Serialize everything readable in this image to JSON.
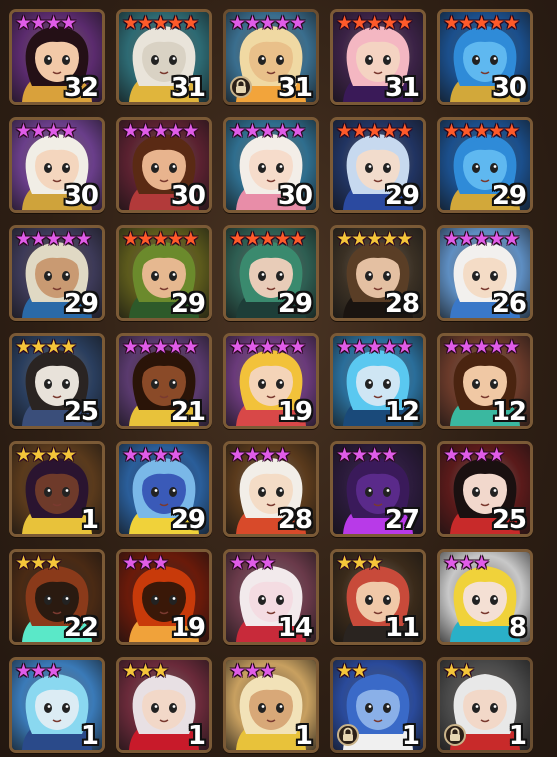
{
  "colors": {
    "star_purple": "#e05ce8",
    "star_red": "#ff5a2a",
    "star_gold": "#f5c53a"
  },
  "monsters": [
    {
      "level": "32",
      "stars": 4,
      "star_color": "#e05ce8",
      "bg": "#5b2b6e",
      "hair": "#241016",
      "skin": "#f2c9a8",
      "accent": "#d9a13b",
      "locked": false
    },
    {
      "level": "31",
      "stars": 5,
      "star_color": "#ff5a2a",
      "bg": "#2d6a73",
      "hair": "#e9e4da",
      "skin": "#d9d2c4",
      "accent": "#e0b53c",
      "locked": false
    },
    {
      "level": "31",
      "stars": 5,
      "star_color": "#e05ce8",
      "bg": "#3a6e8e",
      "hair": "#f0d9a3",
      "skin": "#e9c08a",
      "accent": "#f2a43b",
      "locked": true
    },
    {
      "level": "31",
      "stars": 5,
      "star_color": "#ff5a2a",
      "bg": "#3b2246",
      "hair": "#f4b7c2",
      "skin": "#f4d3c2",
      "accent": "#3a1a58",
      "locked": false
    },
    {
      "level": "30",
      "stars": 5,
      "star_color": "#ff5a2a",
      "bg": "#1b4f8c",
      "hair": "#2f8bd8",
      "skin": "#5fb8f0",
      "accent": "#d2a83a",
      "locked": false
    },
    {
      "level": "30",
      "stars": 4,
      "star_color": "#e05ce8",
      "bg": "#6a3e8a",
      "hair": "#f1eee6",
      "skin": "#f4d6be",
      "accent": "#cfa33b",
      "locked": false
    },
    {
      "level": "30",
      "stars": 5,
      "star_color": "#e05ce8",
      "bg": "#5a2130",
      "hair": "#5a2a14",
      "skin": "#e8b48e",
      "accent": "#b23a3a",
      "locked": false
    },
    {
      "level": "30",
      "stars": 5,
      "star_color": "#e05ce8",
      "bg": "#2f6e8e",
      "hair": "#f3eee8",
      "skin": "#f6dccb",
      "accent": "#e88da8",
      "locked": false
    },
    {
      "level": "29",
      "stars": 5,
      "star_color": "#ff5a2a",
      "bg": "#213462",
      "hair": "#c7d9ef",
      "skin": "#f2dccc",
      "accent": "#2b4aa0",
      "locked": false
    },
    {
      "level": "29",
      "stars": 5,
      "star_color": "#ff5a2a",
      "bg": "#1b4f8c",
      "hair": "#2f8bd8",
      "skin": "#5fb8f0",
      "accent": "#d2a83a",
      "locked": false
    },
    {
      "level": "29",
      "stars": 5,
      "star_color": "#e05ce8",
      "bg": "#3d3a58",
      "hair": "#e0d9c4",
      "skin": "#c99a72",
      "accent": "#2b6aa8",
      "locked": false
    },
    {
      "level": "29",
      "stars": 5,
      "star_color": "#ff5a2a",
      "bg": "#5c5a1c",
      "hair": "#6b8a2c",
      "skin": "#e6b890",
      "accent": "#2e5a2a",
      "locked": false
    },
    {
      "level": "29",
      "stars": 5,
      "star_color": "#ff5a2a",
      "bg": "#2e5e52",
      "hair": "#3a8a6e",
      "skin": "#e8ccb8",
      "accent": "#1e3e38",
      "locked": false
    },
    {
      "level": "28",
      "stars": 5,
      "star_color": "#f5c53a",
      "bg": "#3a3024",
      "hair": "#5a3e26",
      "skin": "#e4c0a2",
      "accent": "#1a1410",
      "locked": false
    },
    {
      "level": "26",
      "stars": 5,
      "star_color": "#e05ce8",
      "bg": "#5e8ec2",
      "hair": "#f2f0ee",
      "skin": "#f4dcc6",
      "accent": "#3a78c8",
      "locked": false
    },
    {
      "level": "25",
      "stars": 4,
      "star_color": "#f5c53a",
      "bg": "#2a3e5e",
      "hair": "#2a2422",
      "skin": "#e8e2da",
      "accent": "#3a4e7a",
      "locked": false
    },
    {
      "level": "21",
      "stars": 5,
      "star_color": "#e05ce8",
      "bg": "#5a3a6e",
      "hair": "#2a1408",
      "skin": "#8a4a28",
      "accent": "#e8c23a",
      "locked": false
    },
    {
      "level": "19",
      "stars": 5,
      "star_color": "#e05ce8",
      "bg": "#6a3a7a",
      "hair": "#f2c23a",
      "skin": "#f4d4b8",
      "accent": "#d84848",
      "locked": false
    },
    {
      "level": "12",
      "stars": 5,
      "star_color": "#e05ce8",
      "bg": "#2a6e9a",
      "hair": "#5ac8f0",
      "skin": "#cfe6f4",
      "accent": "#1a4a7a",
      "locked": false
    },
    {
      "level": "12",
      "stars": 5,
      "star_color": "#e05ce8",
      "bg": "#6a3a2a",
      "hair": "#4a2410",
      "skin": "#f0c8a4",
      "accent": "#3ab8a0",
      "locked": false
    },
    {
      "level": "1",
      "stars": 4,
      "star_color": "#f5c53a",
      "bg": "#5a3a1c",
      "hair": "#2a1430",
      "skin": "#6e3a2a",
      "accent": "#e8c23a",
      "locked": false
    },
    {
      "level": "29",
      "stars": 4,
      "star_color": "#e05ce8",
      "bg": "#2a5e9a",
      "hair": "#7ab8e8",
      "skin": "#3a5ab8",
      "accent": "#f0d23a",
      "locked": false
    },
    {
      "level": "28",
      "stars": 4,
      "star_color": "#e05ce8",
      "bg": "#5a3a1c",
      "hair": "#f2eee8",
      "skin": "#f4dcc6",
      "accent": "#d84a2a",
      "locked": false
    },
    {
      "level": "27",
      "stars": 4,
      "star_color": "#e05ce8",
      "bg": "#2a1a3a",
      "hair": "#3a1a5a",
      "skin": "#5a2a8a",
      "accent": "#b83ae8",
      "locked": false
    },
    {
      "level": "25",
      "stars": 4,
      "star_color": "#e05ce8",
      "bg": "#5a1a1a",
      "hair": "#1a1010",
      "skin": "#f2d8cc",
      "accent": "#c82a2a",
      "locked": false
    },
    {
      "level": "22",
      "stars": 3,
      "star_color": "#f5c53a",
      "bg": "#4a2a14",
      "hair": "#8a3a1a",
      "skin": "#2a1a10",
      "accent": "#5ae8c8",
      "locked": false
    },
    {
      "level": "19",
      "stars": 3,
      "star_color": "#e05ce8",
      "bg": "#6a1a0a",
      "hair": "#c83a0a",
      "skin": "#3a1808",
      "accent": "#f0a23a",
      "locked": false
    },
    {
      "level": "14",
      "stars": 3,
      "star_color": "#e05ce8",
      "bg": "#6a3a4a",
      "hair": "#f2eaec",
      "skin": "#f4dce2",
      "accent": "#c82a3a",
      "locked": false
    },
    {
      "level": "11",
      "stars": 3,
      "star_color": "#f5c53a",
      "bg": "#3a2a1a",
      "hair": "#c84a3a",
      "skin": "#f0c8a8",
      "accent": "#2a2420",
      "locked": false
    },
    {
      "level": "8",
      "stars": 3,
      "star_color": "#e05ce8",
      "bg": "#c8c8c8",
      "hair": "#f0d23a",
      "skin": "#f4e0d4",
      "accent": "#2ab0c8",
      "locked": false
    },
    {
      "level": "1",
      "stars": 3,
      "star_color": "#e05ce8",
      "bg": "#3a7ab8",
      "hair": "#8ad8f0",
      "skin": "#dcecf4",
      "accent": "#2a4a8a",
      "locked": false
    },
    {
      "level": "1",
      "stars": 3,
      "star_color": "#f5c53a",
      "bg": "#6a2a3a",
      "hair": "#e8e0e4",
      "skin": "#f2d8c8",
      "accent": "#c81a2a",
      "locked": false
    },
    {
      "level": "1",
      "stars": 3,
      "star_color": "#e05ce8",
      "bg": "#c8a060",
      "hair": "#f2e2b8",
      "skin": "#d8a878",
      "accent": "#e8c23a",
      "locked": false
    },
    {
      "level": "1",
      "stars": 2,
      "star_color": "#f5c53a",
      "bg": "#2a4a9a",
      "hair": "#3a6ac8",
      "skin": "#8ab0e8",
      "accent": "#f0f0f0",
      "locked": true
    },
    {
      "level": "1",
      "stars": 2,
      "star_color": "#f5c53a",
      "bg": "#4a4a4a",
      "hair": "#e8e8e8",
      "skin": "#f2d8c8",
      "accent": "#c82a2a",
      "locked": true
    }
  ]
}
